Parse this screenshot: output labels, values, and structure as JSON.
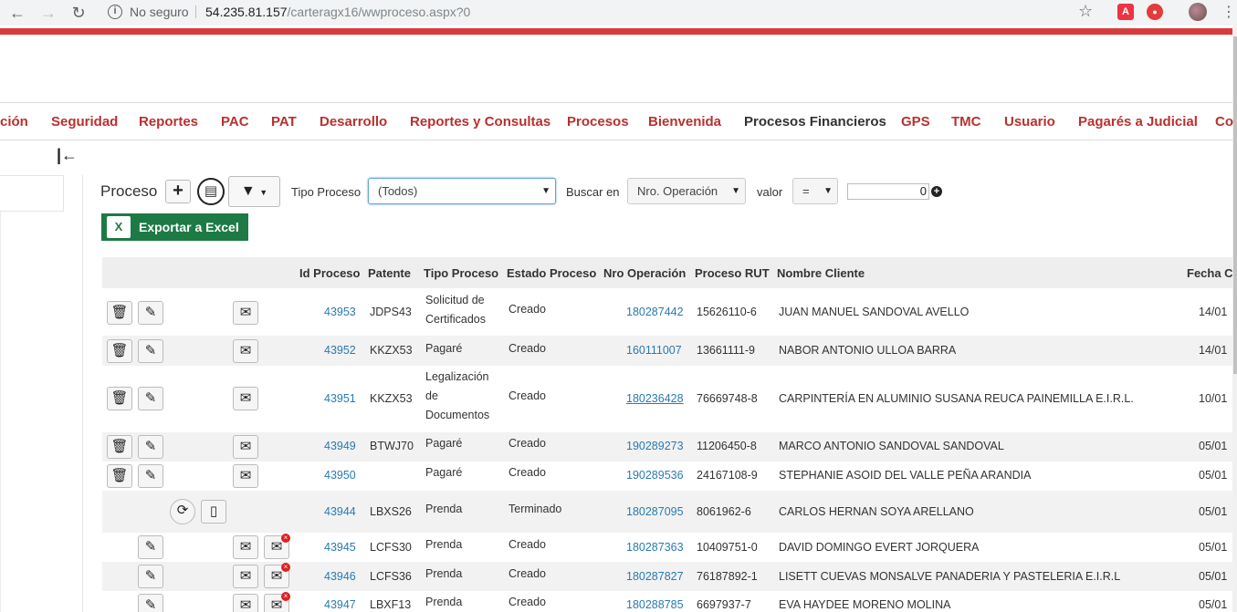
{
  "browser": {
    "security_label": "No seguro",
    "url_host": "54.235.81.157",
    "url_path": "/carteragx16/wwproceso.aspx?0"
  },
  "menu": [
    "ción",
    "Seguridad",
    "Reportes",
    "PAC",
    "PAT",
    "Desarrollo",
    "Reportes y Consultas",
    "Procesos",
    "Bienvenida",
    "Procesos Financieros",
    "GPS",
    "TMC",
    "Usuario",
    "Pagarés a Judicial",
    "Co"
  ],
  "toolbar": {
    "title": "Proceso",
    "tipo_label": "Tipo Proceso",
    "tipo_value": "(Todos)",
    "buscar_label": "Buscar en",
    "buscar_value": "Nro. Operación",
    "valor_label": "valor",
    "operator_value": "=",
    "valor_input": "0",
    "excel_label": "Exportar a Excel"
  },
  "table": {
    "headers": [
      "Id Proceso",
      "Patente",
      "Tipo Proceso",
      "Estado Proceso",
      "Nro Operación",
      "Proceso RUT",
      "Nombre Cliente",
      "Fecha C"
    ],
    "rows": [
      {
        "id": "43953",
        "patente": "JDPS43",
        "tipo": "Solicitud de Certificados",
        "estado": "Creado",
        "nro": "180287442",
        "rut": "15626110-6",
        "cliente": "JUAN MANUEL SANDOVAL AVELLO",
        "fecha": "14/01"
      },
      {
        "id": "43952",
        "patente": "KKZX53",
        "tipo": "Pagaré",
        "estado": "Creado",
        "nro": "160111007",
        "rut": "13661111-9",
        "cliente": "NABOR ANTONIO ULLOA BARRA",
        "fecha": "14/01"
      },
      {
        "id": "43951",
        "patente": "KKZX53",
        "tipo": "Legalización de Documentos",
        "estado": "Creado",
        "nro": "180236428",
        "rut": "76669748-8",
        "cliente": "CARPINTERÍA EN ALUMINIO SUSANA REUCA PAINEMILLA E.I.R.L.",
        "fecha": "10/01"
      },
      {
        "id": "43949",
        "patente": "BTWJ70",
        "tipo": "Pagaré",
        "estado": "Creado",
        "nro": "190289273",
        "rut": "11206450-8",
        "cliente": "MARCO ANTONIO SANDOVAL SANDOVAL",
        "fecha": "05/01"
      },
      {
        "id": "43950",
        "patente": "",
        "tipo": "Pagaré",
        "estado": "Creado",
        "nro": "190289536",
        "rut": "24167108-9",
        "cliente": "STEPHANIE ASOID DEL VALLE PEÑA ARANDIA",
        "fecha": "05/01"
      },
      {
        "id": "43944",
        "patente": "LBXS26",
        "tipo": "Prenda",
        "estado": "Terminado",
        "nro": "180287095",
        "rut": "8061962-6",
        "cliente": "CARLOS HERNAN SOYA ARELLANO",
        "fecha": "05/01"
      },
      {
        "id": "43945",
        "patente": "LCFS30",
        "tipo": "Prenda",
        "estado": "Creado",
        "nro": "180287363",
        "rut": "10409751-0",
        "cliente": "DAVID DOMINGO EVERT JORQUERA",
        "fecha": "05/01"
      },
      {
        "id": "43946",
        "patente": "LCFS36",
        "tipo": "Prenda",
        "estado": "Creado",
        "nro": "180287827",
        "rut": "76187892-1",
        "cliente": "LISETT CUEVAS MONSALVE PANADERIA Y PASTELERIA E.I.R.L",
        "fecha": "05/01"
      },
      {
        "id": "43947",
        "patente": "LBXF13",
        "tipo": "Prenda",
        "estado": "Creado",
        "nro": "180288785",
        "rut": "6697937-7",
        "cliente": "EVA HAYDEE MORENO MOLINA",
        "fecha": "05/01"
      }
    ]
  }
}
